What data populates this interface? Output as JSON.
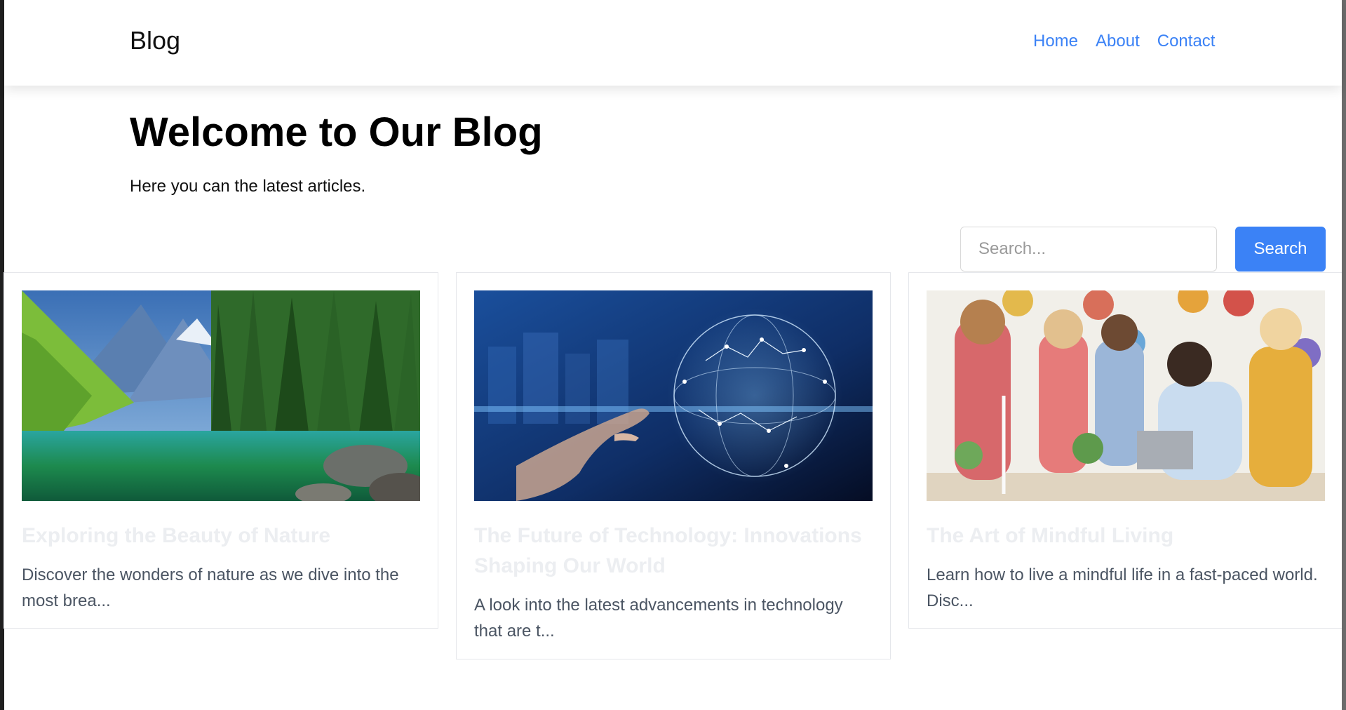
{
  "navbar": {
    "brand": "Blog",
    "links": [
      "Home",
      "About",
      "Contact"
    ]
  },
  "hero": {
    "title": "Welcome to Our Blog",
    "subtitle": "Here you can the latest articles."
  },
  "search": {
    "placeholder": "Search...",
    "button_label": "Search"
  },
  "posts": [
    {
      "title": "Exploring the Beauty of Nature",
      "excerpt": "Discover the wonders of nature as we dive into the most brea...",
      "image_icon": "nature-landscape-image"
    },
    {
      "title": "The Future of Technology: Innovations Shaping Our World",
      "excerpt": "A look into the latest advancements in technology that are t...",
      "image_icon": "technology-globe-image"
    },
    {
      "title": "The Art of Mindful Living",
      "excerpt": "Learn how to live a mindful life in a fast-paced world. Disc...",
      "image_icon": "classroom-image"
    }
  ],
  "colors": {
    "accent": "#3b82f6",
    "card_title": "#eceef1",
    "excerpt": "#4b5563"
  }
}
